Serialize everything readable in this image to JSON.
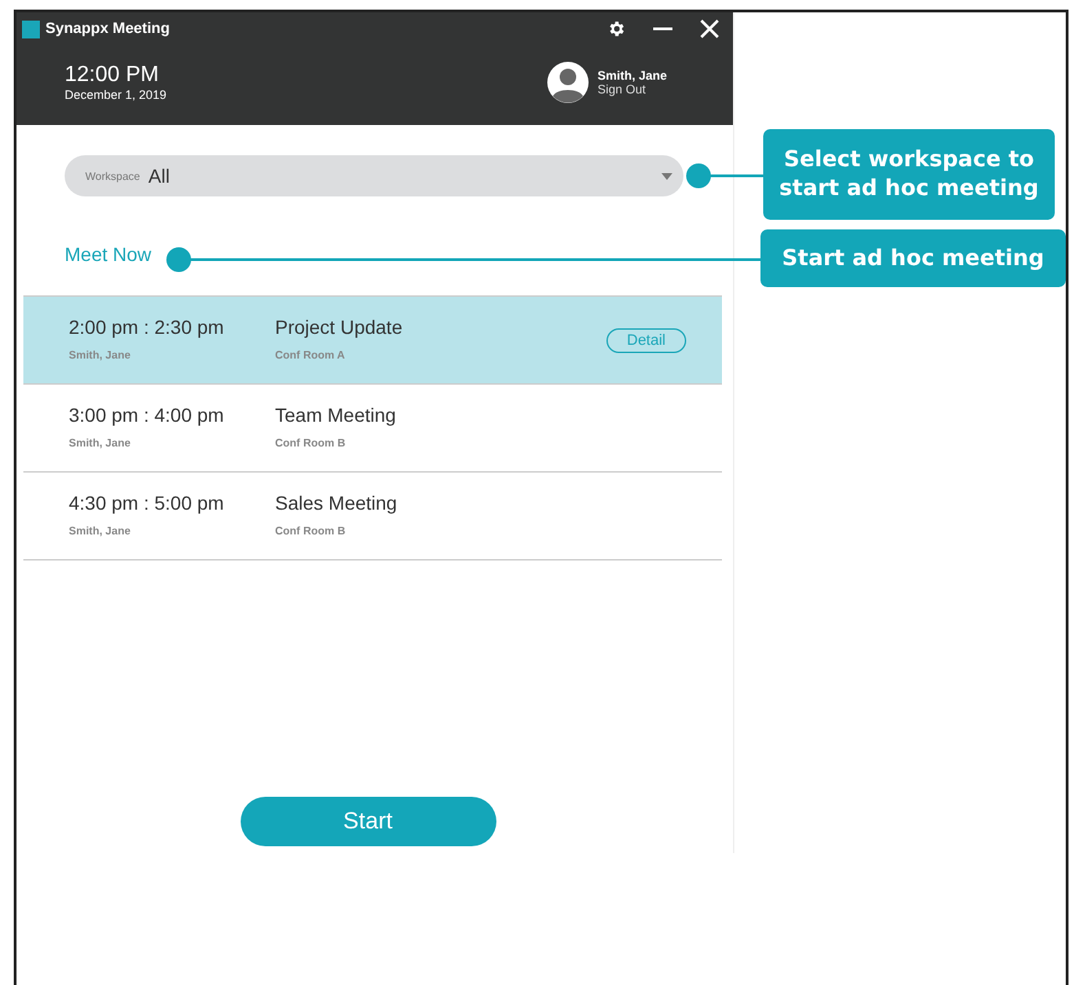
{
  "window": {
    "title": "Synappx Meeting"
  },
  "header": {
    "time": "12:00 PM",
    "date": "December 1, 2019",
    "user": "Smith, Jane",
    "sign_out": "Sign Out"
  },
  "workspace": {
    "label": "Workspace",
    "value": "All"
  },
  "meet_now": "Meet Now",
  "meetings": [
    {
      "time": "2:00 pm : 2:30 pm",
      "organizer": "Smith, Jane",
      "title": "Project Update",
      "room": "Conf Room A",
      "selected": true,
      "action": "Detail"
    },
    {
      "time": "3:00 pm : 4:00 pm",
      "organizer": "Smith, Jane",
      "title": "Team Meeting",
      "room": "Conf Room B",
      "selected": false
    },
    {
      "time": "4:30 pm : 5:00 pm",
      "organizer": "Smith, Jane",
      "title": "Sales Meeting",
      "room": "Conf Room B",
      "selected": false
    }
  ],
  "start_button": "Start",
  "callouts": [
    {
      "text": "Select workspace to start ad hoc meeting",
      "kind": "dropdown"
    },
    {
      "text": "Start ad hoc meeting",
      "kind": "link"
    }
  ]
}
